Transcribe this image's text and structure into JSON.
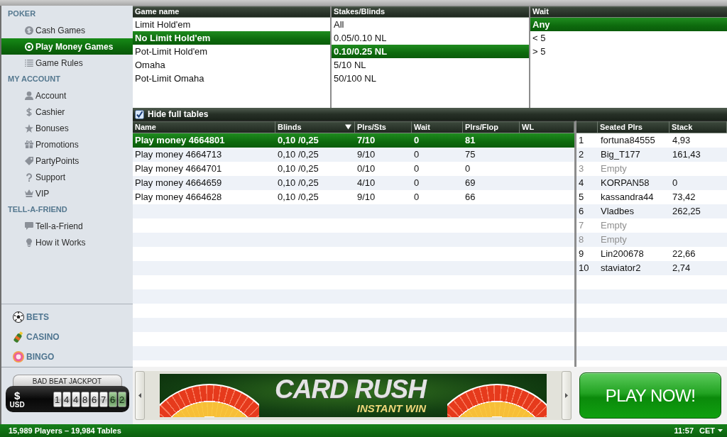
{
  "sidebar": {
    "sections": [
      {
        "title": "POKER",
        "items": [
          {
            "label": "Cash Games",
            "selected": false
          },
          {
            "label": "Play Money Games",
            "selected": true
          },
          {
            "label": "Game Rules",
            "selected": false
          }
        ]
      },
      {
        "title": "MY ACCOUNT",
        "items": [
          {
            "label": "Account",
            "selected": false
          },
          {
            "label": "Cashier",
            "selected": false
          },
          {
            "label": "Bonuses",
            "selected": false
          },
          {
            "label": "Promotions",
            "selected": false
          },
          {
            "label": "PartyPoints",
            "selected": false
          },
          {
            "label": "Support",
            "selected": false
          },
          {
            "label": "VIP",
            "selected": false
          }
        ]
      },
      {
        "title": "TELL-A-FRIEND",
        "items": [
          {
            "label": "Tell-a-Friend",
            "selected": false
          },
          {
            "label": "How it Works",
            "selected": false
          }
        ]
      }
    ],
    "products": [
      {
        "label": "BETS"
      },
      {
        "label": "CASINO"
      },
      {
        "label": "BINGO"
      }
    ]
  },
  "jackpot": {
    "title": "BAD BEAT JACKPOT",
    "symbol": "$",
    "currency": "USD",
    "digits": [
      "1",
      "4",
      "4",
      "8",
      "6",
      "7"
    ],
    "cent_digits": [
      "6",
      "2"
    ]
  },
  "filters": [
    {
      "title": "Game name",
      "options": [
        {
          "label": "Limit Hold'em",
          "selected": false
        },
        {
          "label": "No Limit Hold'em",
          "selected": true
        },
        {
          "label": "Pot-Limit Hold'em",
          "selected": false
        },
        {
          "label": "Omaha",
          "selected": false
        },
        {
          "label": "Pot-Limit Omaha",
          "selected": false
        }
      ]
    },
    {
      "title": "Stakes/Blinds",
      "options": [
        {
          "label": "All",
          "selected": false
        },
        {
          "label": "0.05/0.10 NL",
          "selected": false
        },
        {
          "label": "0.10/0.25 NL",
          "selected": true
        },
        {
          "label": "5/10 NL",
          "selected": false
        },
        {
          "label": "50/100 NL",
          "selected": false
        }
      ]
    },
    {
      "title": "Wait",
      "options": [
        {
          "label": "Any",
          "selected": true
        },
        {
          "label": "< 5",
          "selected": false
        },
        {
          "label": "> 5",
          "selected": false
        }
      ]
    }
  ],
  "hide_full_tables": {
    "label": "Hide full tables",
    "checked": true
  },
  "tables": {
    "columns": [
      {
        "label": "Name",
        "sorted": false
      },
      {
        "label": "Blinds",
        "sorted": true
      },
      {
        "label": "Plrs/Sts",
        "sorted": false
      },
      {
        "label": "Wait",
        "sorted": false
      },
      {
        "label": "Plrs/Flop",
        "sorted": false
      },
      {
        "label": "WL",
        "sorted": false
      }
    ],
    "rows": [
      {
        "cells": [
          "Play money 4664801",
          "0,10 /0,25",
          "7/10",
          "0",
          "81"
        ],
        "selected": true
      },
      {
        "cells": [
          "Play money 4664713",
          "0,10 /0,25",
          "9/10",
          "0",
          "75"
        ],
        "selected": false
      },
      {
        "cells": [
          "Play money 4664701",
          "0,10 /0,25",
          "0/10",
          "0",
          "0"
        ],
        "selected": false
      },
      {
        "cells": [
          "Play money 4664659",
          "0,10 /0,25",
          "4/10",
          "0",
          "69"
        ],
        "selected": false
      },
      {
        "cells": [
          "Play money 4664628",
          "0,10 /0,25",
          "9/10",
          "0",
          "66"
        ],
        "selected": false
      }
    ]
  },
  "seats": {
    "columns": [
      {
        "label": "Seated Plrs"
      },
      {
        "label": "Stack"
      }
    ],
    "rows": [
      {
        "seat": "1",
        "player": "fortuna84555",
        "stack": "4,93",
        "empty": false
      },
      {
        "seat": "2",
        "player": "Big_T177",
        "stack": "161,43",
        "empty": false
      },
      {
        "seat": "3",
        "player": "Empty",
        "empty": true
      },
      {
        "seat": "4",
        "player": "KORPAN58",
        "stack": "0",
        "empty": false
      },
      {
        "seat": "5",
        "player": "kassandra44",
        "stack": "73,42",
        "empty": false
      },
      {
        "seat": "6",
        "player": "Vladbes",
        "stack": "262,25",
        "empty": false
      },
      {
        "seat": "7",
        "player": "Empty",
        "empty": true
      },
      {
        "seat": "8",
        "player": "Empty",
        "empty": true
      },
      {
        "seat": "9",
        "player": "Lin200678",
        "stack": "22,66",
        "empty": false
      },
      {
        "seat": "10",
        "player": "staviator2",
        "stack": "2,74",
        "empty": false
      }
    ]
  },
  "promo": {
    "banner": {
      "title": "CARD RUSH",
      "subtitle": "INSTANT WIN"
    },
    "play_button": {
      "label": "PLAY NOW!"
    }
  },
  "status_bar": {
    "summary": "15,989 Players – 19,984 Tables",
    "time": "11:57",
    "timezone": "CET"
  }
}
